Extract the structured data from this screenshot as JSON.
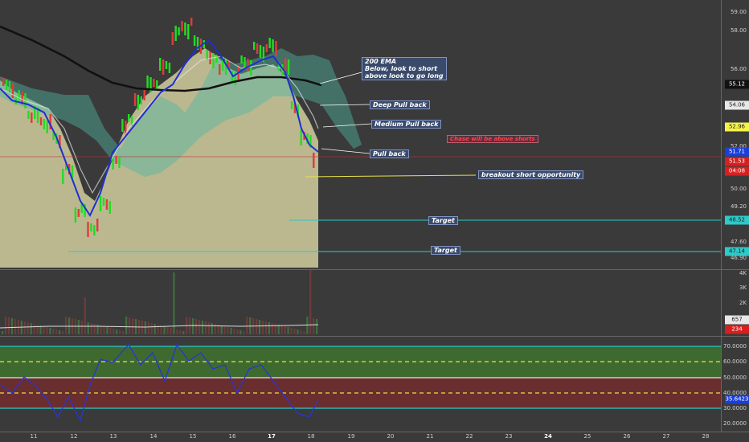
{
  "price_scale": {
    "ticks": [
      "59.00",
      "58.00",
      "56.00",
      "52.00",
      "50.00",
      "49.20",
      "47.60",
      "46.90"
    ],
    "badges": [
      {
        "text": "55.12",
        "bg": "#111111",
        "fg": "#ffffff"
      },
      {
        "text": "54.06",
        "bg": "#e8e8e8",
        "fg": "#222222"
      },
      {
        "text": "52.96",
        "bg": "#f5f24a",
        "fg": "#222222"
      },
      {
        "text": "51.71",
        "bg": "#1a3fd8",
        "fg": "#ffffff"
      },
      {
        "text": "51.53",
        "bg": "#d62020",
        "fg": "#ffffff"
      },
      {
        "text": "04:08",
        "bg": "#d62020",
        "fg": "#ffffff"
      },
      {
        "text": "48.52",
        "bg": "#2ec9c9",
        "fg": "#222222"
      },
      {
        "text": "47.14",
        "bg": "#2ec9c9",
        "fg": "#222222"
      }
    ]
  },
  "volume_scale": {
    "ticks": [
      "4K",
      "3K",
      "2K",
      "1K"
    ],
    "badges": [
      {
        "text": "657",
        "bg": "#e8e8e8",
        "fg": "#222222"
      },
      {
        "text": "234",
        "bg": "#d62020",
        "fg": "#ffffff"
      }
    ]
  },
  "rsi_scale": {
    "ticks": [
      "70.0000",
      "60.0000",
      "50.0000",
      "40.0000",
      "30.0000",
      "20.0000"
    ],
    "badge": {
      "text": "35.6423",
      "bg": "#1a3fd8",
      "fg": "#ffffff"
    }
  },
  "annotations": {
    "ema200": "200 EMA\nBelow, look to short\nabove look to go long",
    "deep": "Deep Pull back",
    "medium": "Medium Pull back",
    "pullback": "Pull back",
    "breakout": "breakout short opportunity",
    "target1": "Target",
    "target2": "Target",
    "chase": "Chase will be above shorts"
  },
  "x_axis": {
    "labels": [
      "11",
      "12",
      "13",
      "14",
      "15",
      "16",
      "17",
      "18",
      "19",
      "20",
      "21",
      "22",
      "23",
      "24",
      "25",
      "26",
      "27",
      "28"
    ],
    "bold": [
      "17",
      "24"
    ]
  },
  "colors": {
    "background": "#3a3a3a",
    "up_candle": "#22dd22",
    "down_candle": "#e23a3a",
    "ema200": "#111111",
    "ema_fast": "#1f2fd0",
    "ribbon": "#d2cfa0",
    "rsi_line": "#2436d9",
    "target_line": "#2ec9c9",
    "rsi_upper_zone": "#3f6a2f",
    "rsi_lower_zone": "#6a2e2e"
  },
  "chart_data": {
    "type": "line",
    "series": [
      {
        "name": "200 EMA",
        "values": [
          57.6,
          57.0,
          56.2,
          55.6,
          55.3,
          55.2,
          55.3,
          55.6,
          55.8,
          55.6,
          55.4,
          55.12
        ]
      }
    ],
    "levels": {
      "target_1": 48.52,
      "target_2": 47.14,
      "last": 51.53
    },
    "rsi": {
      "levels": [
        70,
        60,
        50,
        40,
        30
      ],
      "last": 35.6423
    }
  }
}
